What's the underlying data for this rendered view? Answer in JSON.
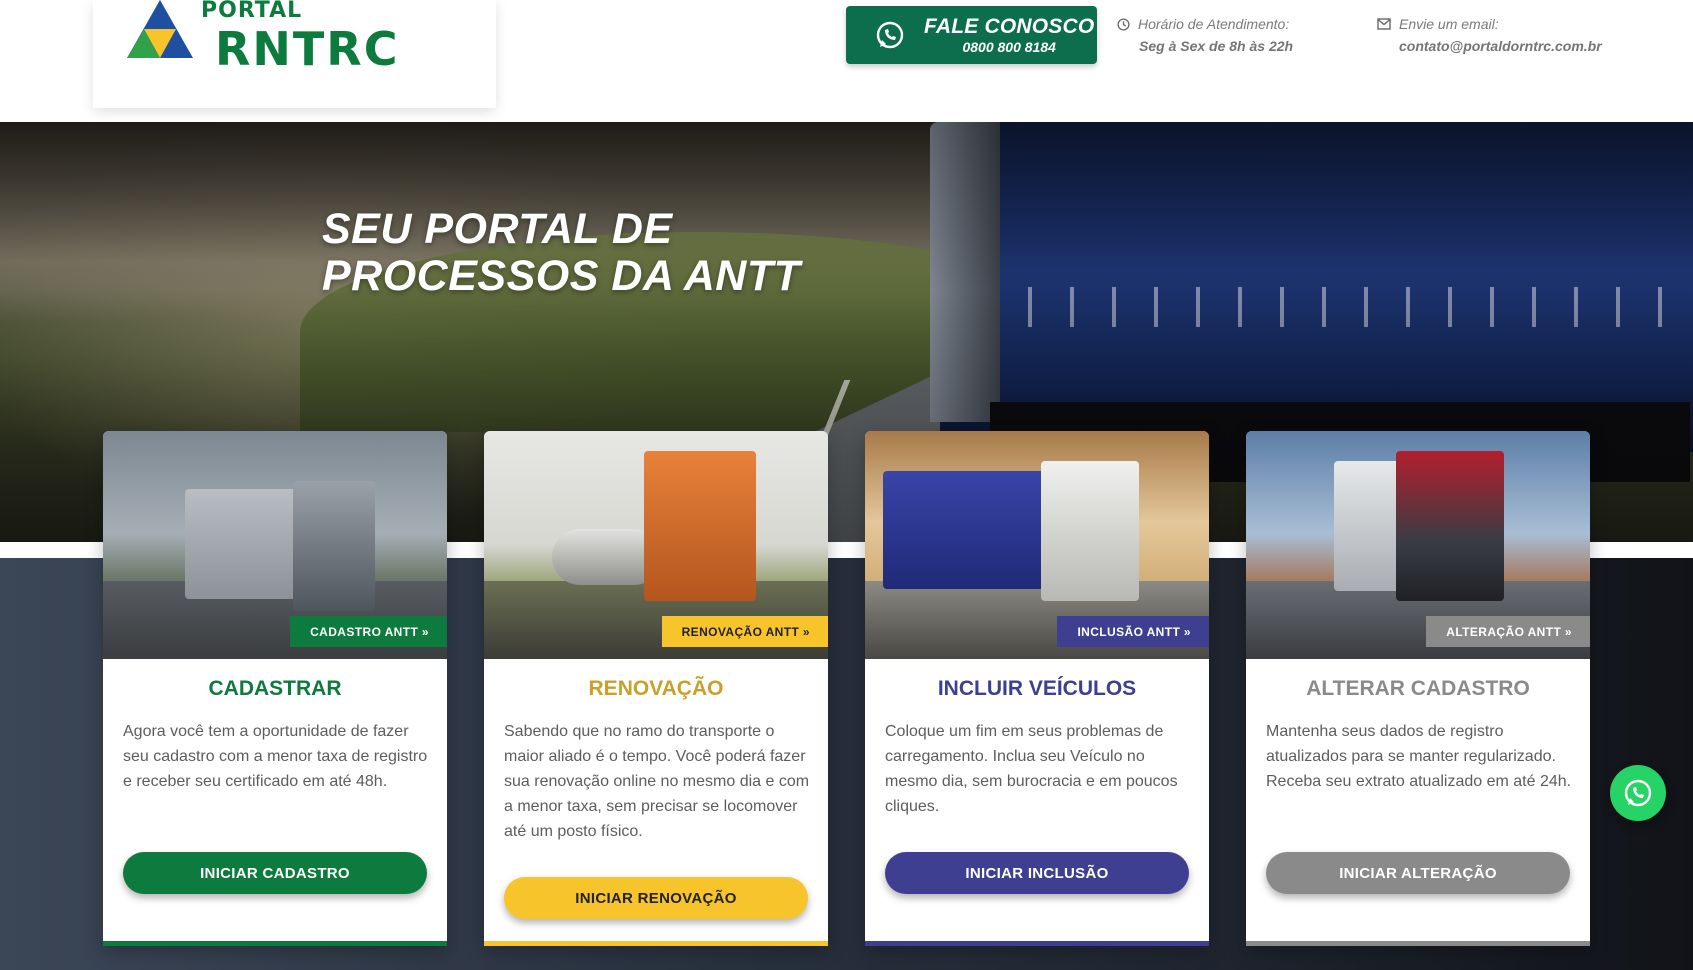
{
  "brand": {
    "small": "PORTAL",
    "big": "RNTRC",
    "colors": {
      "green": "#0d7a3e",
      "yellow": "#f7c52b",
      "blue": "#3e3f91",
      "gray": "#8a8a8a"
    }
  },
  "header": {
    "contact": {
      "title": "FALE CONOSCO",
      "phone": "0800 800 8184",
      "icon": "whatsapp-icon"
    },
    "hours": {
      "label": "Horário de Atendimento:",
      "value": "Seg à Sex de 8h às 22h",
      "icon": "clock-icon"
    },
    "email": {
      "label": "Envie um email:",
      "value": "contato@portaldorntrc.com.br",
      "icon": "envelope-icon"
    }
  },
  "hero": {
    "title_line1": "SEU PORTAL DE",
    "title_line2": "PROCESSOS DA ANTT"
  },
  "cards": [
    {
      "badge": "CADASTRO ANTT »",
      "title": "CADASTRAR",
      "description": "Agora você tem a oportunidade de fazer seu cadastro com a menor taxa de registro e receber seu certificado em até 48h.",
      "button": "INICIAR CADASTRO",
      "color": "#0d7a3e",
      "button_text_color": "#ffffff"
    },
    {
      "badge": "RENOVAÇÃO ANTT »",
      "title": "RENOVAÇÃO",
      "description": "Sabendo que no ramo do transporte o maior aliado é o tempo. Você poderá fazer sua renovação online no mesmo dia e com a menor taxa, sem precisar se locomover até um posto físico.",
      "button": "INICIAR RENOVAÇÃO",
      "color": "#f7c52b",
      "title_color": "#c9a12a",
      "button_text_color": "#222222"
    },
    {
      "badge": "INCLUSÃO ANTT »",
      "title": "INCLUIR VEÍCULOS",
      "description": "Coloque um fim em seus problemas de carregamento. Inclua seu Veículo no mesmo dia, sem burocracia e em poucos cliques.",
      "button": "INICIAR INCLUSÃO",
      "color": "#3e3f91",
      "button_text_color": "#ffffff"
    },
    {
      "badge": "ALTERAÇÃO ANTT »",
      "title": "ALTERAR CADASTRO",
      "description": "Mantenha seus dados de registro atualizados para se manter regularizado. Receba seu extrato atualizado em até 24h.",
      "button": "INICIAR ALTERAÇÃO",
      "color": "#8a8a8a",
      "button_text_color": "#ffffff"
    }
  ],
  "floating": {
    "icon": "whatsapp-icon"
  }
}
